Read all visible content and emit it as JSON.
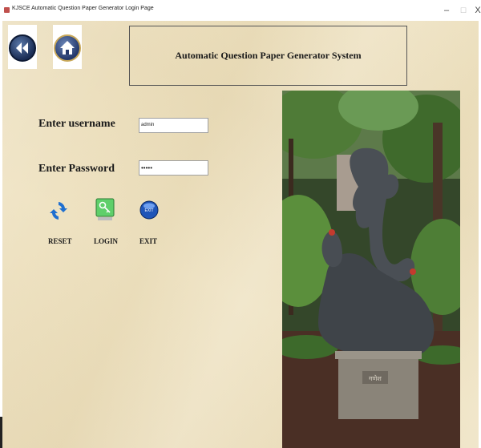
{
  "window": {
    "title": "KJSCE Automatic Question Paper Generator Login Page",
    "minimize_label": "–",
    "maximize_label": "☐",
    "close_label": "X"
  },
  "nav": {
    "back_icon": "back-arrow-icon",
    "home_icon": "home-icon"
  },
  "header": {
    "title": "Automatic Question Paper Generator System"
  },
  "form": {
    "username_label": "Enter username",
    "username_value": "admin",
    "password_label": "Enter Password",
    "password_value": "•••••"
  },
  "actions": {
    "reset_label": "RESET",
    "login_label": "LOGIN",
    "exit_label": "EXIT"
  },
  "photo": {
    "plaque_text": "गणेश"
  },
  "colors": {
    "background": "#efe3c3",
    "accent_blue": "#1f4e8a",
    "login_green": "#3aa84a"
  }
}
